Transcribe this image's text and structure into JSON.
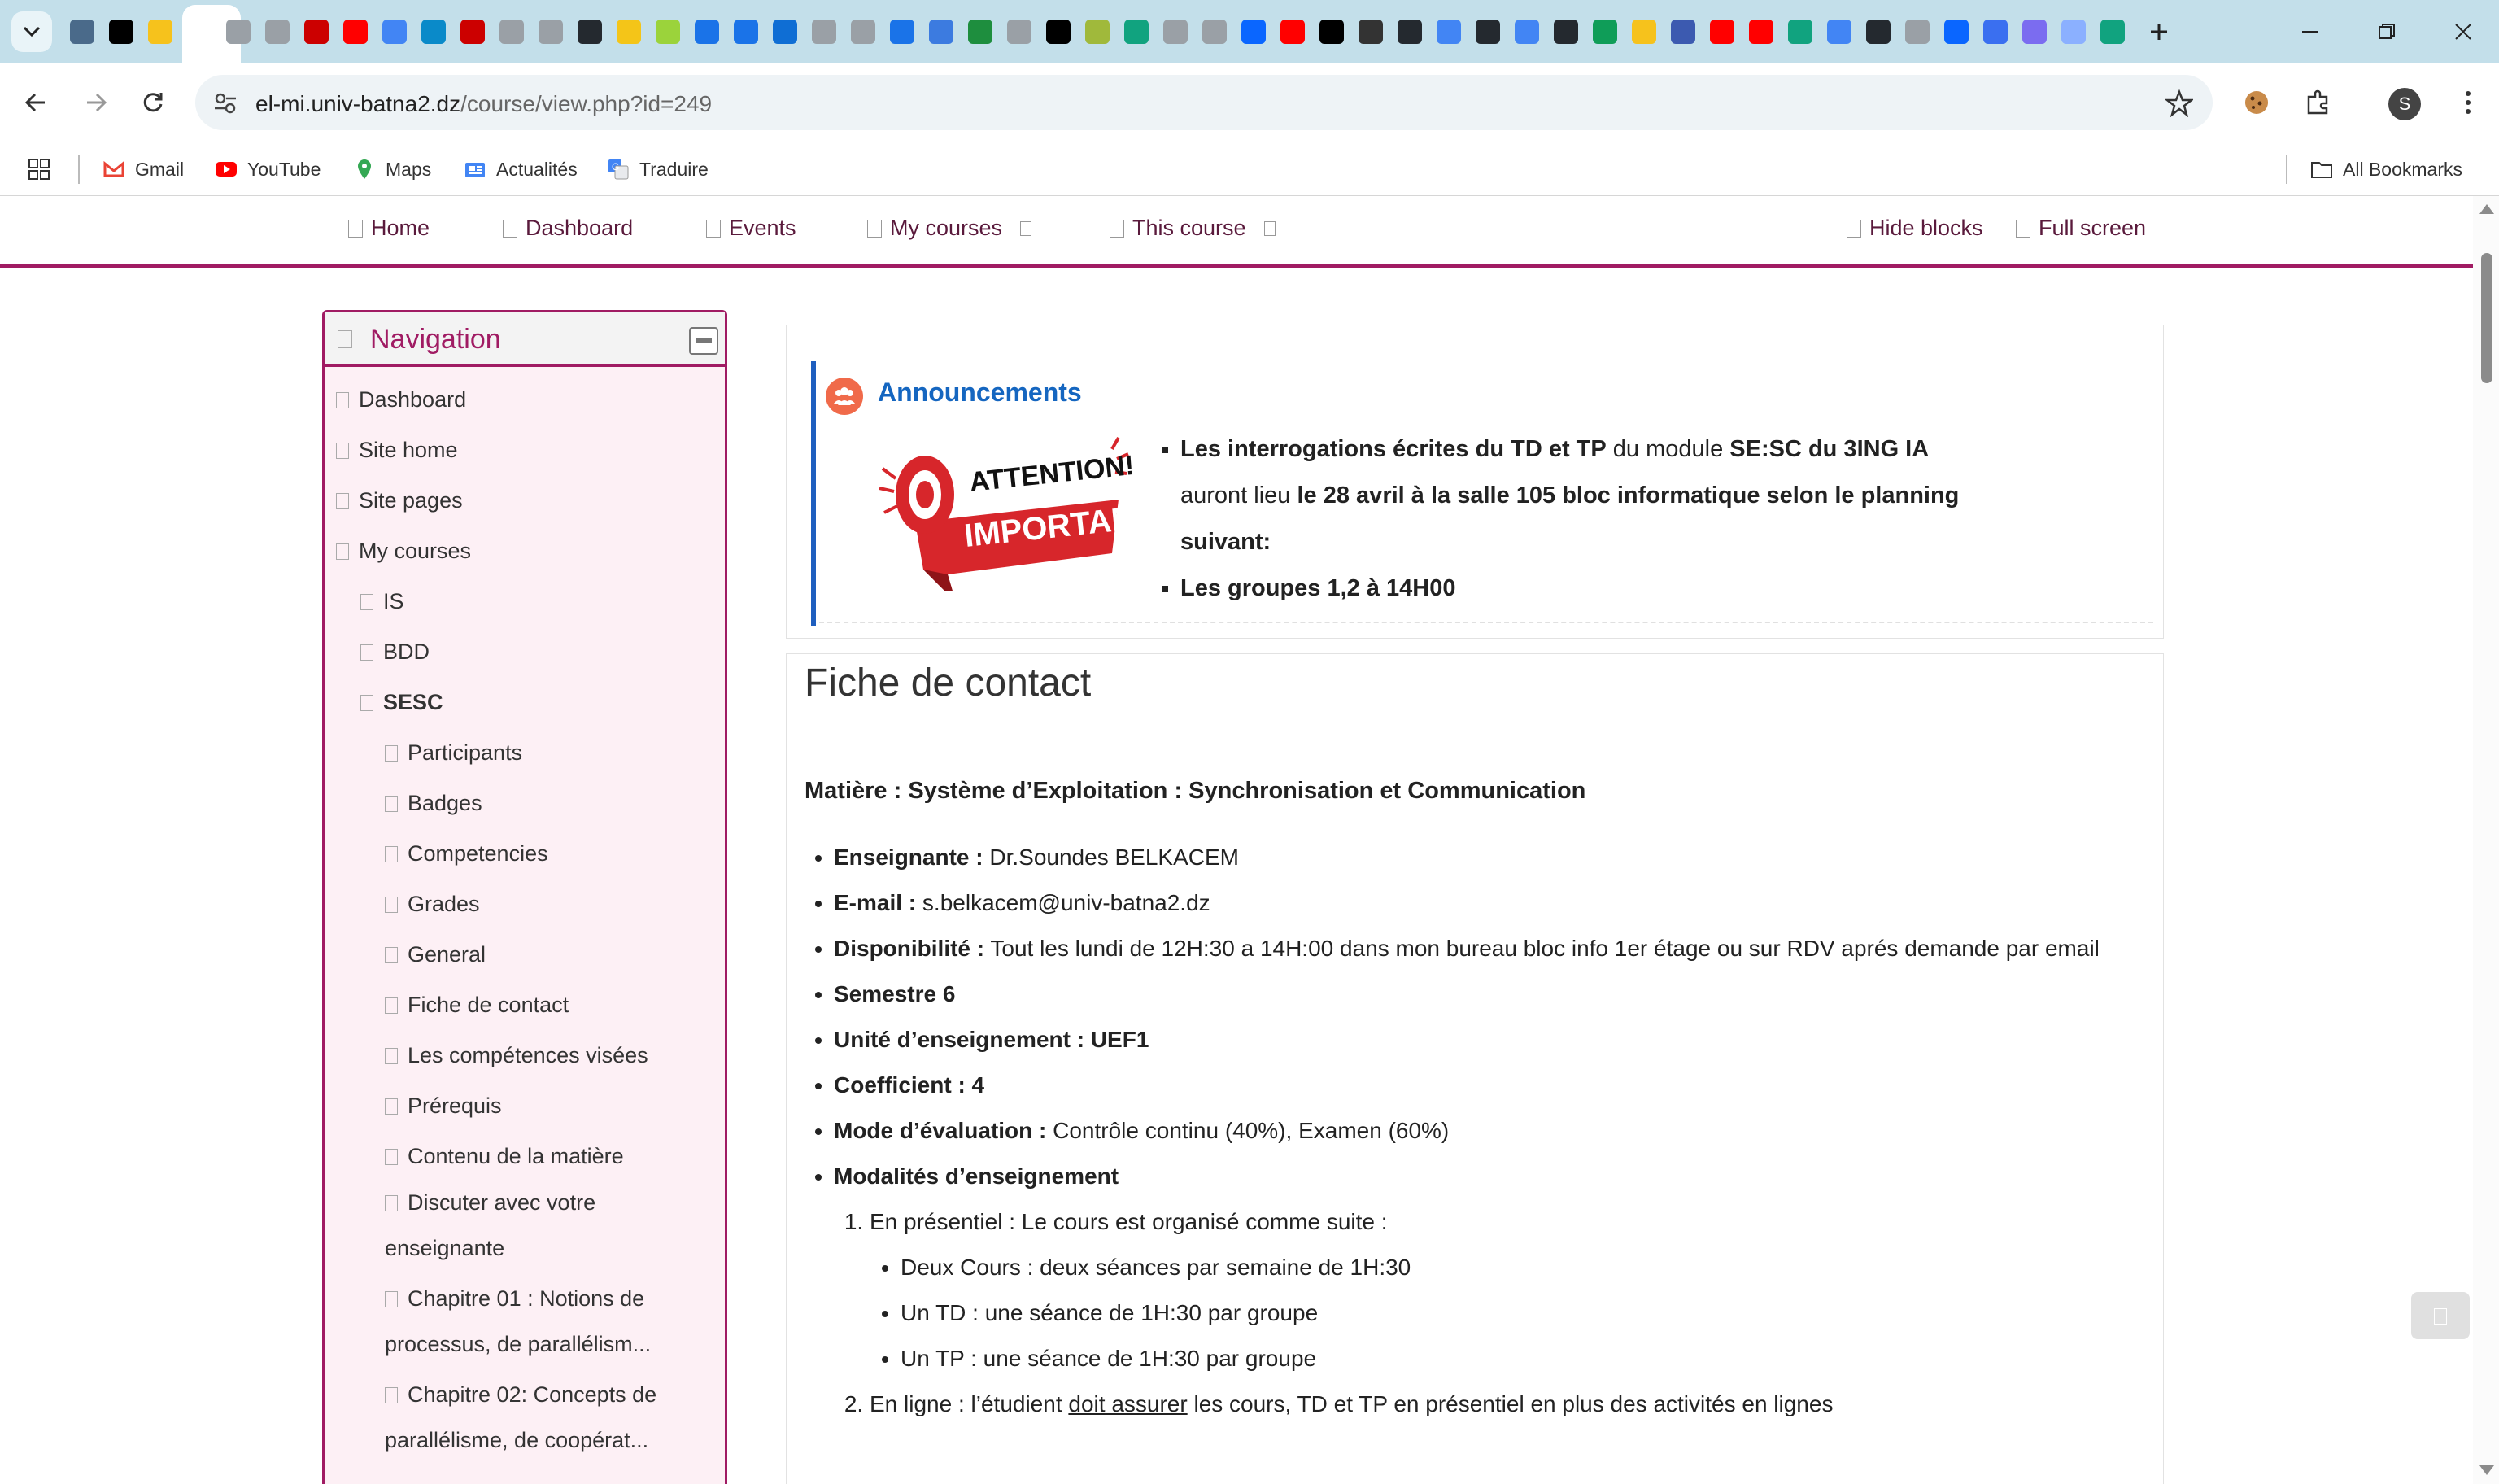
{
  "browser": {
    "url_domain": "el-mi.univ-batna2.dz",
    "url_path": "/course/view.php?id=249",
    "profile_initial": "S",
    "tab_colors": [
      "#4a6a8a",
      "#000000",
      "#f6c21c",
      "#ffffff",
      "#9aa0a6",
      "#9aa0a6",
      "#cc0000",
      "#ff0000",
      "#4285f4",
      "#0a8ac9",
      "#cc0000",
      "#9aa0a6",
      "#9aa0a6",
      "#24292f",
      "#f4c518",
      "#9bd33b",
      "#1a73e8",
      "#1a73e8",
      "#0f6ed4",
      "#9aa0a6",
      "#9aa0a6",
      "#1a73e8",
      "#3c7be0",
      "#1e8e3e",
      "#9aa0a6",
      "#000000",
      "#a0b93b",
      "#11a37f",
      "#9aa0a6",
      "#9aa0a6",
      "#0a66ff",
      "#ff0000",
      "#000000",
      "#333333",
      "#24292f",
      "#4285f4",
      "#24292f",
      "#4285f4",
      "#24292f",
      "#0f9d58",
      "#f6c21c",
      "#3c5ab0",
      "#ff0000",
      "#ff0000",
      "#11a37f",
      "#4285f4",
      "#24292f",
      "#9aa0a6",
      "#0a66ff",
      "#3a6ff0",
      "#7b6cf0",
      "#8bb0ff",
      "#11a37f"
    ]
  },
  "bookmarks": [
    {
      "label": "Gmail",
      "icon": "gmail-icon"
    },
    {
      "label": "YouTube",
      "icon": "youtube-icon"
    },
    {
      "label": "Maps",
      "icon": "maps-icon"
    },
    {
      "label": "Actualités",
      "icon": "news-icon"
    },
    {
      "label": "Traduire",
      "icon": "translate-icon"
    },
    {
      "label": "All Bookmarks",
      "icon": "folder-icon"
    }
  ],
  "topnav": {
    "home": "Home",
    "dashboard": "Dashboard",
    "events": "Events",
    "my_courses": "My courses",
    "this_course": "This course",
    "hide_blocks": "Hide blocks",
    "full_screen": "Full screen"
  },
  "navigation": {
    "title": "Navigation",
    "items": [
      {
        "label": "Dashboard",
        "level": 0
      },
      {
        "label": "Site home",
        "level": 0
      },
      {
        "label": "Site pages",
        "level": 0
      },
      {
        "label": "My courses",
        "level": 0
      },
      {
        "label": "IS",
        "level": 1
      },
      {
        "label": "BDD",
        "level": 1
      },
      {
        "label": "SESC",
        "level": 1,
        "bold": true
      },
      {
        "label": "Participants",
        "level": 2
      },
      {
        "label": "Badges",
        "level": 2
      },
      {
        "label": "Competencies",
        "level": 2
      },
      {
        "label": "Grades",
        "level": 2
      },
      {
        "label": "General",
        "level": 2
      },
      {
        "label": "Fiche de contact",
        "level": 2
      },
      {
        "label": "Les compétences visées",
        "level": 2
      },
      {
        "label": "Prérequis",
        "level": 2
      },
      {
        "label": "Contenu de la matière",
        "level": 2
      },
      {
        "label": "Discuter avec votre enseignante",
        "level": 2
      },
      {
        "label": "Chapitre 01 : Notions de processus, de parallélism...",
        "level": 2
      },
      {
        "label": "Chapitre 02: Concepts de parallélisme, de coopérat...",
        "level": 2
      }
    ]
  },
  "announcements": {
    "title": "Announcements",
    "image_text_1": "ATTENTION!",
    "image_text_2": "IMPORTANT",
    "line1_a": "Les ",
    "line1_b": "interrogations écrites du TD et TP",
    "line1_c": " du module ",
    "line1_d": "SE:SC du 3ING IA",
    "line1_e": " auront lieu ",
    "line1_f": "le 28 avril à la salle 105 bloc informatique",
    "line1_g": " selon le planning suivant:",
    "line2": "Les groupes 1,2  à 14H00"
  },
  "contact": {
    "title": "Fiche de contact",
    "matiere": "Matière : Système d’Exploitation : Synchronisation et Communication",
    "enseignante_label": "Enseignante :",
    "enseignante_value": " Dr.Soundes BELKACEM",
    "email_label": "E-mail :",
    "email_value": " s.belkacem@univ-batna2.dz",
    "dispo_label": "Disponibilité :",
    "dispo_value": " Tout les lundi de 12H:30 a 14H:00 dans mon bureau bloc info 1er étage ou sur RDV aprés demande par email",
    "semestre": "Semestre 6",
    "unite": "Unité d’enseignement : UEF1",
    "coef": "Coefficient : 4",
    "mode_label": "Mode d’évaluation :",
    "mode_value": " Contrôle continu (40%), Examen (60%)",
    "modalites": "Modalités d’enseignement",
    "presentiel": "En présentiel : Le cours est organisé comme suite :",
    "sub1": "Deux Cours : deux séances par semaine de 1H:30",
    "sub2": "Un TD : une séance de 1H:30 par groupe",
    "sub3": "Un TP : une séance de 1H:30 par groupe",
    "enligne_a": "En ligne : l’étudient ",
    "enligne_b": "doit assurer",
    "enligne_c": " les cours, TD et TP en présentiel en plus des activités en lignes"
  }
}
